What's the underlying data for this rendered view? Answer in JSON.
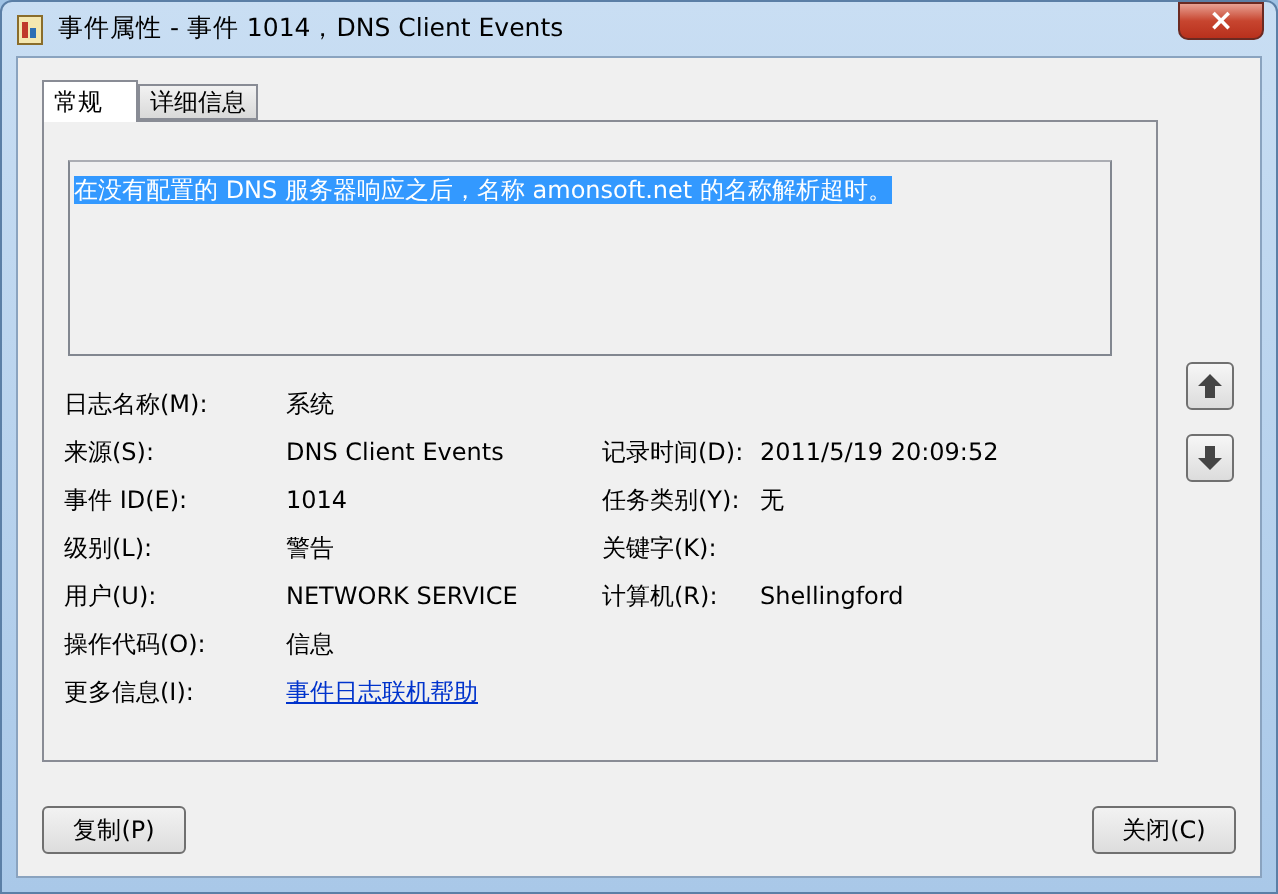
{
  "window": {
    "title": "事件属性 - 事件 1014，DNS Client Events",
    "close": "×"
  },
  "tabs": [
    {
      "label": "常规",
      "selected": true
    },
    {
      "label": "详细信息",
      "selected": false
    }
  ],
  "message": "在没有配置的 DNS 服务器响应之后，名称 amonsoft.net 的名称解析超时。",
  "fields": [
    [
      {
        "label": "日志名称(M):",
        "value": "系统"
      }
    ],
    [
      {
        "label": "来源(S):",
        "value": "DNS Client Events"
      },
      {
        "label": "记录时间(D):",
        "value": "2011/5/19 20:09:52"
      }
    ],
    [
      {
        "label": "事件 ID(E):",
        "value": "1014"
      },
      {
        "label": "任务类别(Y):",
        "value": "无"
      }
    ],
    [
      {
        "label": "级别(L):",
        "value": "警告"
      },
      {
        "label": "关键字(K):"
      }
    ],
    [
      {
        "label": "用户(U):",
        "value": "NETWORK SERVICE"
      },
      {
        "label": "计算机(R):",
        "value": "Shellingford"
      }
    ],
    [
      {
        "label": "操作代码(O):",
        "value": "信息"
      }
    ],
    [
      {
        "label": "更多信息(I):",
        "link": "事件日志联机帮助"
      }
    ]
  ],
  "buttons": [
    "复制(P)",
    "关闭(C)"
  ]
}
